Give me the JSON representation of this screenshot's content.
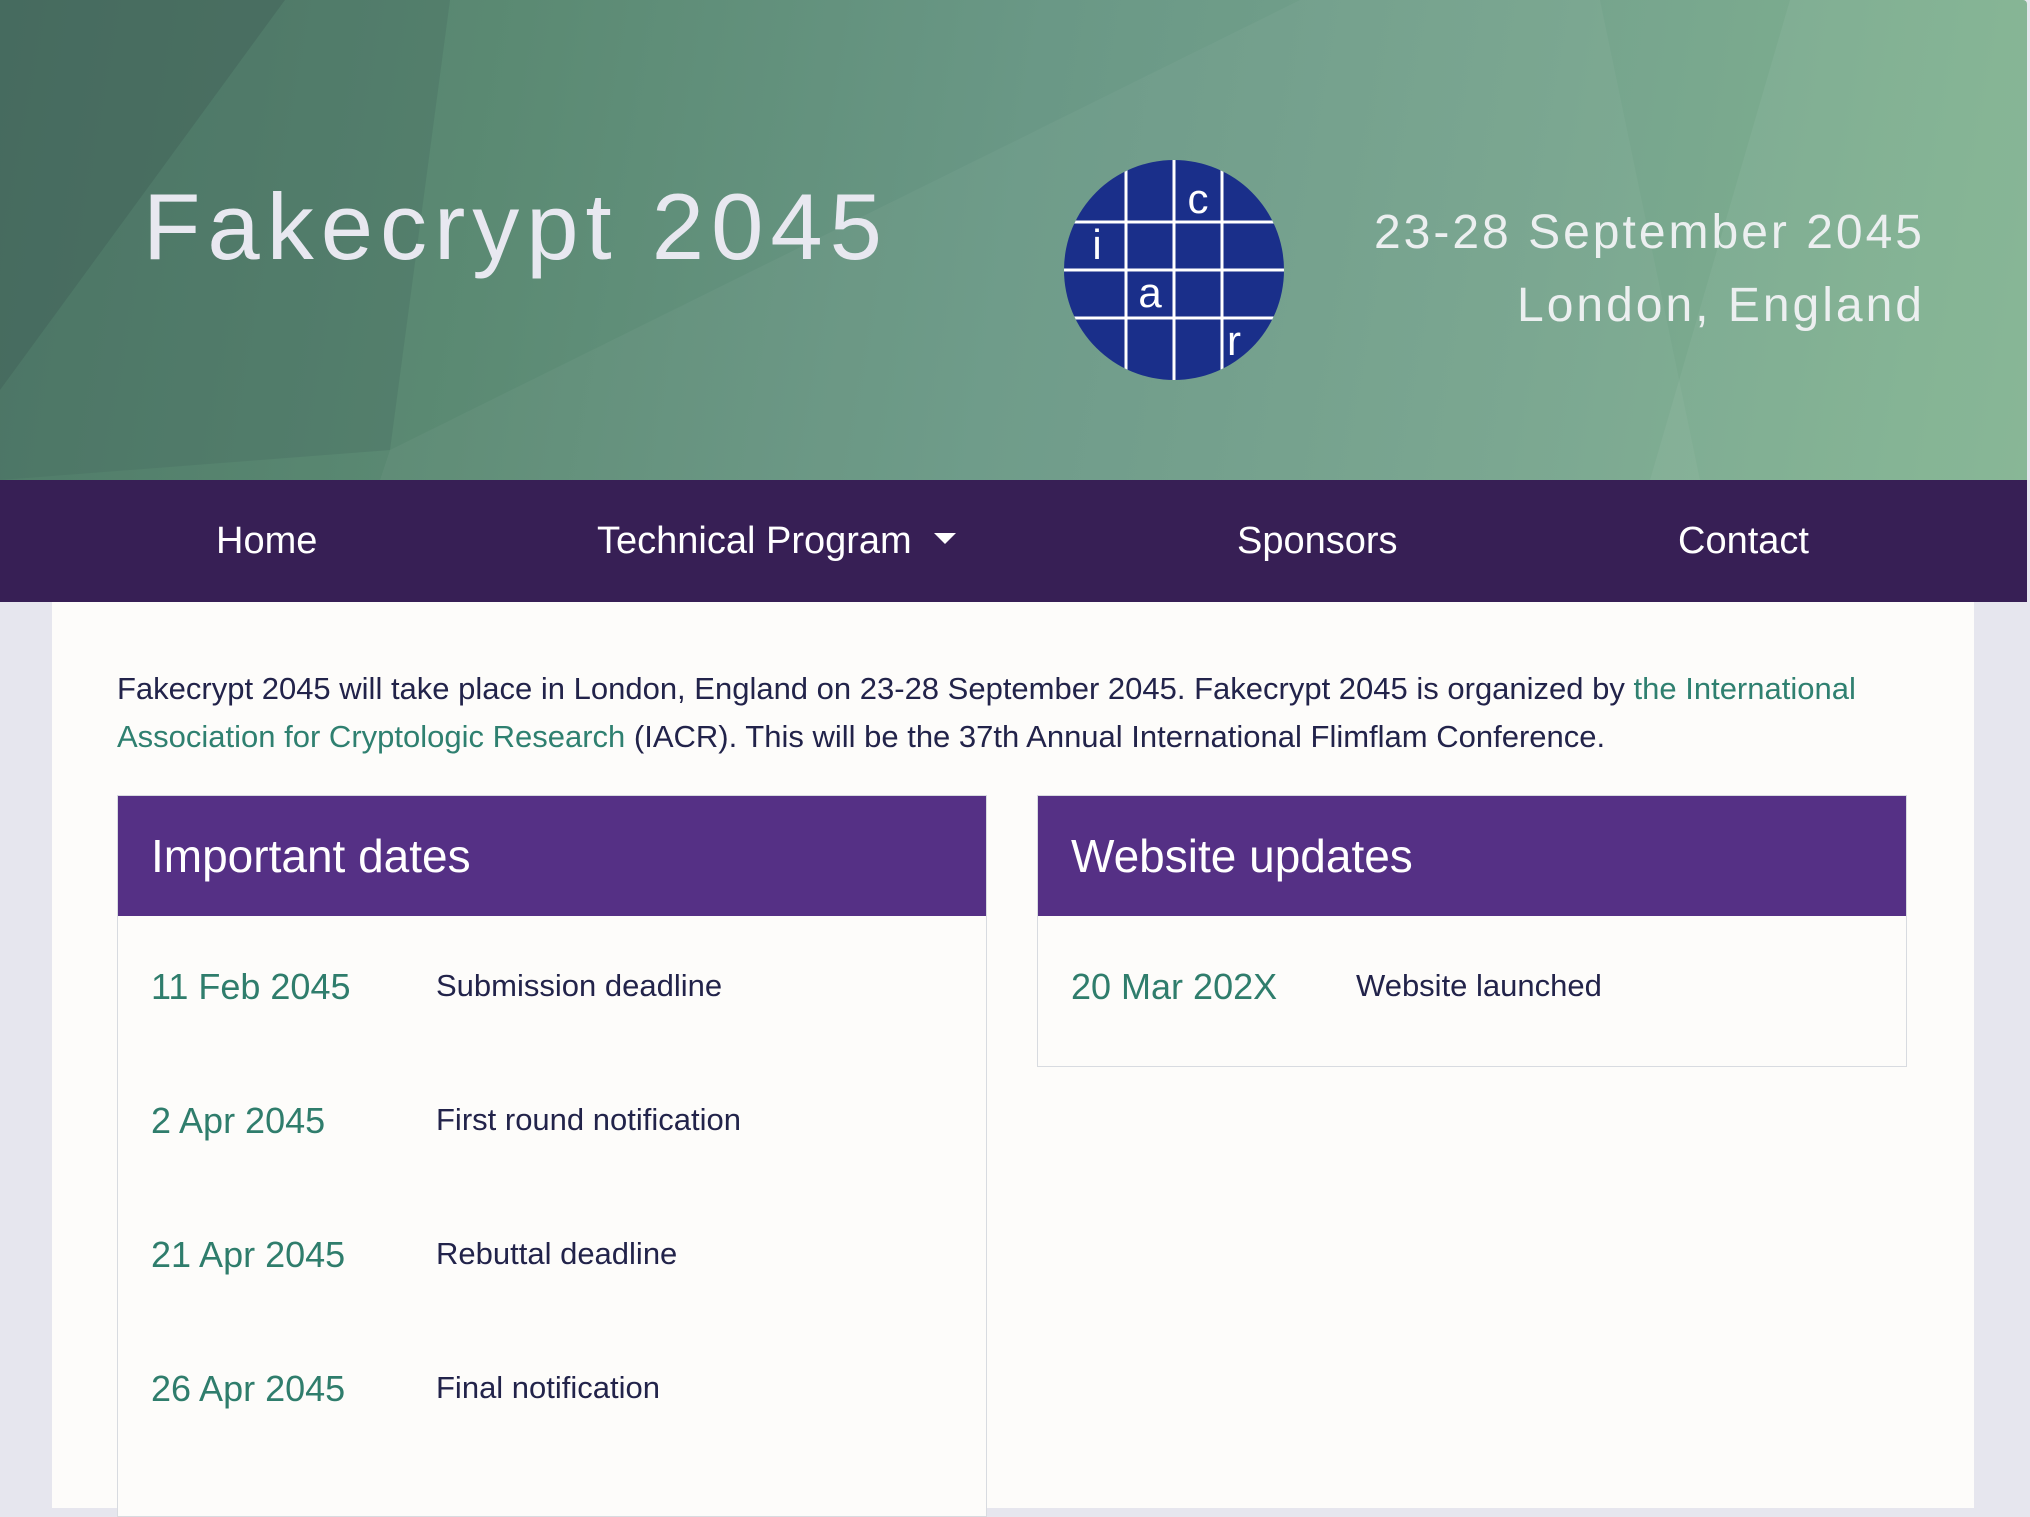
{
  "header": {
    "title": "Fakecrypt 2045",
    "dates": "23-28 September 2045",
    "location": "London, England",
    "logo_letters": [
      "c",
      "i",
      "a",
      "r"
    ],
    "logo_icon": "iacr-logo-icon"
  },
  "colors": {
    "banner_gradient_start": "#4f7a68",
    "banner_gradient_end": "#82b491",
    "navbar": "#371f55",
    "card_header": "#553085",
    "link": "#2f8070",
    "logo_circle": "#1a2f8a"
  },
  "nav": {
    "items": [
      {
        "label": "Home"
      },
      {
        "label": "Technical Program",
        "icon": "caret-down-icon"
      },
      {
        "label": "Sponsors"
      },
      {
        "label": "Contact"
      }
    ]
  },
  "intro": {
    "text_before_link": "Fakecrypt 2045 will take place in London, England on 23-28 September 2045. Fakecrypt 2045 is organized by ",
    "link_text": "the International Association for Cryptologic Research",
    "text_after_link": " (IACR). This will be the 37th Annual International Flimflam Conference."
  },
  "important_dates": {
    "title": "Important dates",
    "rows": [
      {
        "date": "11 Feb 2045",
        "event": "Submission deadline"
      },
      {
        "date": "2 Apr 2045",
        "event": "First round notification"
      },
      {
        "date": "21 Apr 2045",
        "event": "Rebuttal deadline"
      },
      {
        "date": "26 Apr 2045",
        "event": "Final notification"
      }
    ]
  },
  "website_updates": {
    "title": "Website updates",
    "rows": [
      {
        "date": "20 Mar 202X",
        "event": "Website launched"
      }
    ]
  }
}
